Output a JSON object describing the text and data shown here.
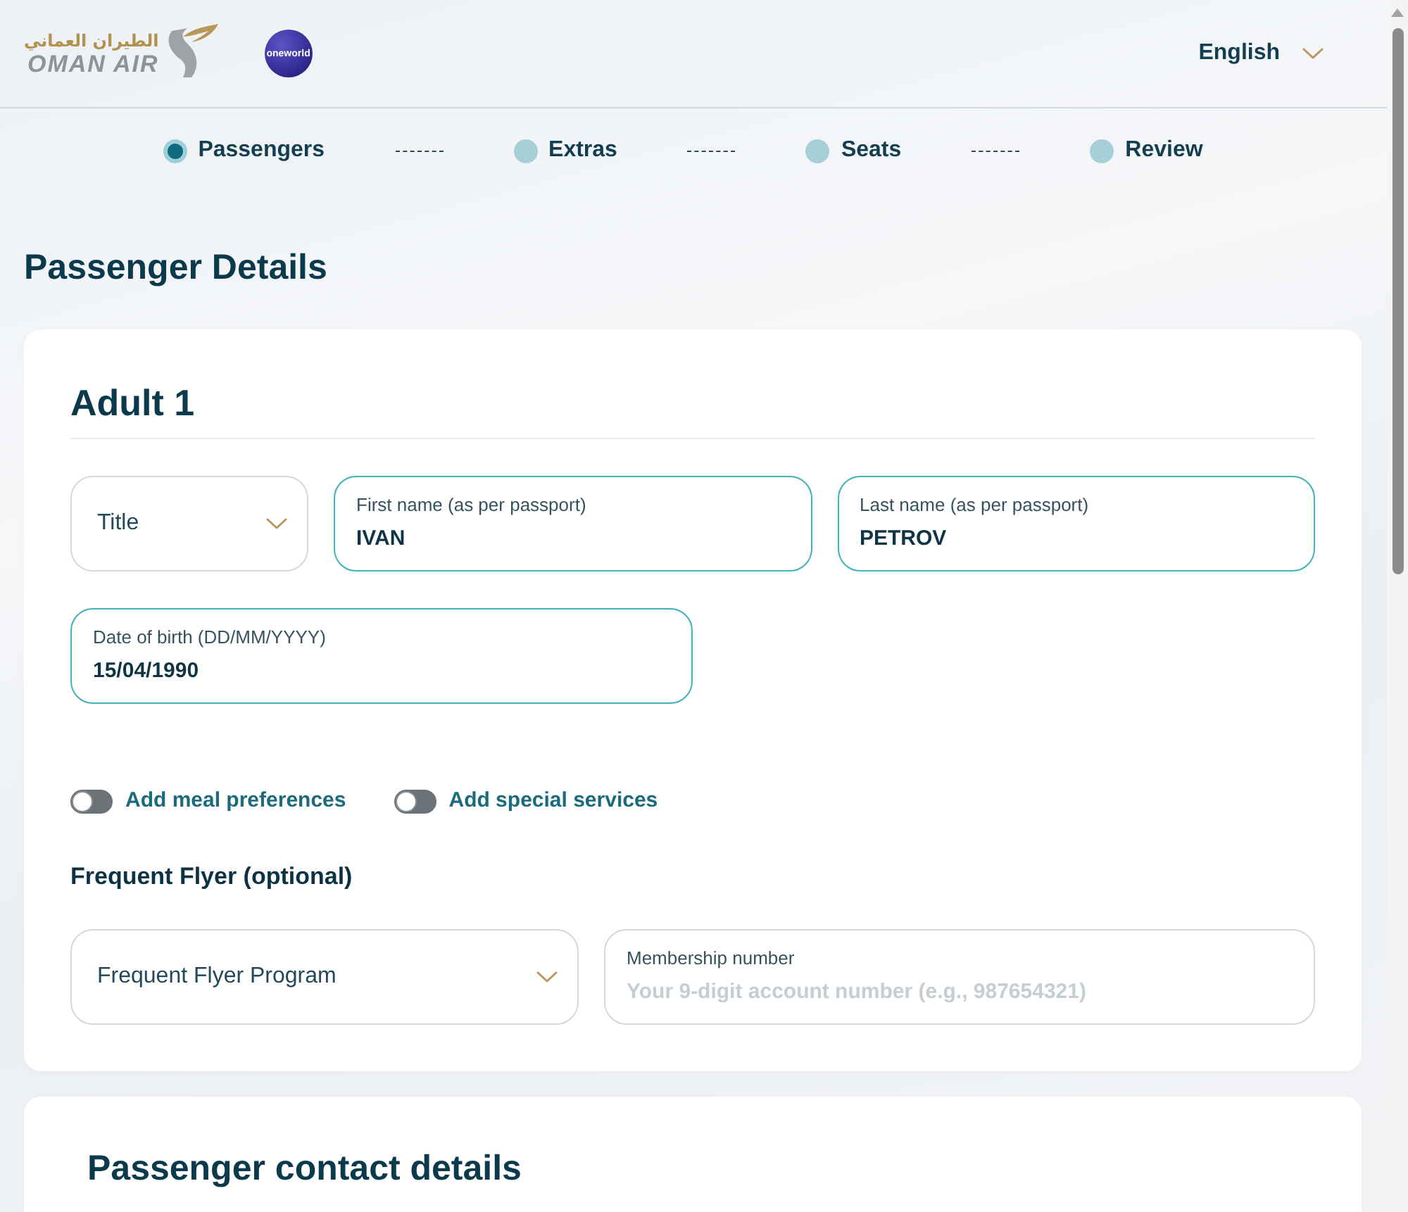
{
  "header": {
    "logo": {
      "arabic_name": "الطيران العماني",
      "name": "OMAN AIR"
    },
    "alliance_logo": "oneworld",
    "language": "English"
  },
  "steps": [
    {
      "label": "Passengers",
      "selected": true
    },
    {
      "label": "Extras",
      "selected": false
    },
    {
      "label": "Seats",
      "selected": false
    },
    {
      "label": "Review",
      "selected": false
    }
  ],
  "page_title": "Passenger Details",
  "passenger": {
    "heading": "Adult 1",
    "rows": [
      [
        {
          "kind": "select",
          "label": "Title"
        },
        {
          "kind": "input",
          "label": "First name (as per passport)",
          "value": "IVAN"
        },
        {
          "kind": "input",
          "label": "Last name (as per passport)",
          "value": "PETROV"
        }
      ],
      [
        {
          "kind": "input",
          "label": "Date of birth (DD/MM/YYYY)",
          "value": "15/04/1990"
        }
      ]
    ],
    "toggles": [
      {
        "label": "Add meal preferences",
        "on": false
      },
      {
        "label": "Add special services",
        "on": false
      }
    ],
    "frequent_flyer": {
      "heading": "Frequent Flyer (optional)",
      "fields": [
        {
          "kind": "select",
          "label": "Frequent Flyer Program"
        },
        {
          "kind": "input",
          "label": "Membership number",
          "placeholder": "Your 9-digit account number (e.g., 987654321)"
        }
      ]
    }
  },
  "contact": {
    "heading": "Passenger contact details"
  }
}
